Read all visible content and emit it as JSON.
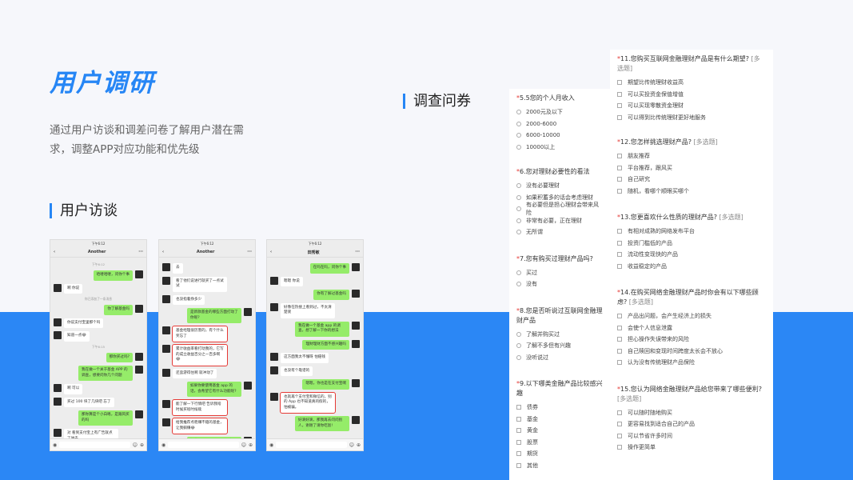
{
  "page": {
    "title": "用户调研",
    "description": "通过用户访谈和调差问卷了解用户潜在需求，调整APP对应功能和优先级",
    "section_survey": "调查问券",
    "section_interview": "用户访谈"
  },
  "chats": [
    {
      "status": "下午6:12",
      "name": "Another",
      "back": "‹",
      "more": "···",
      "messages": [
        {
          "side": "ts",
          "text": "下午6:12"
        },
        {
          "side": "r",
          "text": "哈喽哈喽，问你个事"
        },
        {
          "side": "l",
          "text": "啊 你说"
        },
        {
          "side": "ts",
          "text": "你已添加了一条消息"
        },
        {
          "side": "r",
          "text": "你了解基金吗"
        },
        {
          "side": "l",
          "text": "你说支付宝里那个吗"
        },
        {
          "side": "l",
          "text": "知道一点😂"
        },
        {
          "side": "ts",
          "text": "下午6:15"
        },
        {
          "side": "r",
          "text": "那你买过吗?"
        },
        {
          "side": "r",
          "text": "我在做一个关于基金 APP 的调查，想要问你几个问题"
        },
        {
          "side": "l",
          "text": "啊 可以"
        },
        {
          "side": "l",
          "text": "买过 100 块了几块吧 忘了"
        },
        {
          "side": "r",
          "text": "那你算是个小白咯，是跟风买的吗"
        },
        {
          "side": "l",
          "text": "对 看到支付宝上有广告就点了进去"
        }
      ]
    },
    {
      "status": "下午6:12",
      "name": "Another",
      "back": "‹",
      "more": "···",
      "messages": [
        {
          "side": "l",
          "text": "去"
        },
        {
          "side": "l",
          "text": "看了他们说进行就买了一点试试"
        },
        {
          "side": "l",
          "text": "也没指着挣多少"
        },
        {
          "side": "r",
          "text": "是新款基金的哪些方面打动了你呢?"
        },
        {
          "side": "l",
          "text": "基金经理很厉害的，有个什么奖忘了",
          "hl": true
        },
        {
          "side": "l",
          "text": "累计收益率看打动我的，它写的成立收益百分之一百多啊😂",
          "hl": true
        },
        {
          "side": "l",
          "text": "还蛮游得住啊 就冲动了"
        },
        {
          "side": "r",
          "text": "如果你要使用基金 app 的话，会希望它有什么功能呢?"
        },
        {
          "side": "l",
          "text": "能了解一下行情吧 告诉我啥时候买啥时候赎",
          "hl": true
        },
        {
          "side": "l",
          "text": "给我推荐点稳赚不赔的基金，让我躺赚😂",
          "hl": true
        },
        {
          "side": "r",
          "text": "好嘞 感谢！等我挣钱了请你吃饭!"
        }
      ]
    },
    {
      "status": "下午6:12",
      "name": "田秀敏",
      "back": "‹",
      "more": "···",
      "messages": [
        {
          "side": "r",
          "text": "在吗在吗，问你个事"
        },
        {
          "side": "l",
          "text": "嗯嗯 你说"
        },
        {
          "side": "r",
          "text": "你有了解过基金吗"
        },
        {
          "side": "l",
          "text": "好像在热搜上看到过，不太清楚诶"
        },
        {
          "side": "r",
          "text": "我在做一个基金 app 的调查，想了解一下你的想法"
        },
        {
          "side": "r",
          "text": "理财理财方面不感兴趣吗"
        },
        {
          "side": "l",
          "text": "这方面我太不懂呀 怕赔钱"
        },
        {
          "side": "l",
          "text": "也没有个靠谱的"
        },
        {
          "side": "r",
          "text": "嗯嗯，你也是在支付宝啊"
        },
        {
          "side": "l",
          "text": "也就再个支付宝和微信的，别的 App 也不知道真的假的，怕被骗。",
          "hl": true
        },
        {
          "side": "r",
          "text": "好滴好滴，那我再去问问别人，谢谢了请你吃饭!"
        }
      ]
    }
  ],
  "survey": {
    "card1": {
      "questions": [
        {
          "q": "5.5您的个人月收入",
          "tag": "",
          "type": "radio",
          "options": [
            "2000元及以下",
            "2000-6000",
            "6000-10000",
            "10000以上"
          ]
        },
        {
          "q": "6.您对理财必要性的看法",
          "tag": "",
          "type": "radio",
          "options": [
            "没有必要理财",
            "如果积蓄多的话会考虑理财",
            "有必要但是担心理财会带来风险",
            "非常有必要，正在理财",
            "无所谓"
          ]
        },
        {
          "q": "7.您有购买过理财产品吗?",
          "tag": "",
          "type": "radio",
          "options": [
            "买过",
            "没有"
          ]
        },
        {
          "q": "8.您是否听说过互联网金融理财产品",
          "tag": "",
          "type": "radio",
          "options": [
            "了解并购买过",
            "了解不多但有兴趣",
            "没听说过"
          ]
        },
        {
          "q": "9.以下哪类金融产品比较感兴趣",
          "tag": "",
          "type": "check",
          "options": [
            "债券",
            "基金",
            "黄金",
            "股票",
            "期货",
            "其他"
          ]
        }
      ]
    },
    "card2": {
      "questions": [
        {
          "q": "11.您购买互联网金融理财产品是有什么期望?",
          "tag": "[多选题]",
          "type": "check",
          "options": [
            "期望比传统理财收益高",
            "可以买投资金保值增值",
            "可以买现零散资金理财",
            "可以得到比传统理财更好地服务"
          ]
        },
        {
          "q": "12.您怎样挑选理财产品?",
          "tag": "[多选题]",
          "type": "check",
          "options": [
            "朋友推荐",
            "平台推荐，跟风买",
            "自己研究",
            "随机，看哪个顺眼买哪个"
          ]
        },
        {
          "q": "13.您更喜欢什么性质的理财产品?",
          "tag": "[多选题]",
          "type": "check",
          "options": [
            "有相对成熟的网络发布平台",
            "投资门槛低的产品",
            "流动性变现快的产品",
            "收益稳定的产品"
          ]
        },
        {
          "q": "14.在购买网络金融理财产品时你会有以下哪些顾虑?",
          "tag": "[多选题]",
          "type": "check",
          "options": [
            "产品出问题，会产生经济上的损失",
            "会使个人信息泄露",
            "担心操作失误带来的风险",
            "自己赎回和变现时间跨度太长会不放心",
            "认为没有传统理财产品保险"
          ]
        },
        {
          "q": "15.您认为网络金融理财产品给您带来了哪些便利?",
          "tag": "[多选题]",
          "type": "check",
          "options": [
            "可以随时随地购买",
            "更容易找到适合自己的产品",
            "可以节省许多时间",
            "操作更简单"
          ]
        }
      ]
    }
  },
  "icons": [
    "voice-icon",
    "emoji-icon",
    "plus-icon"
  ],
  "colors": {
    "accent": "#2686f5",
    "band": "#2b87f5",
    "bubble_self": "#95ec69",
    "highlight": "#e53935"
  }
}
